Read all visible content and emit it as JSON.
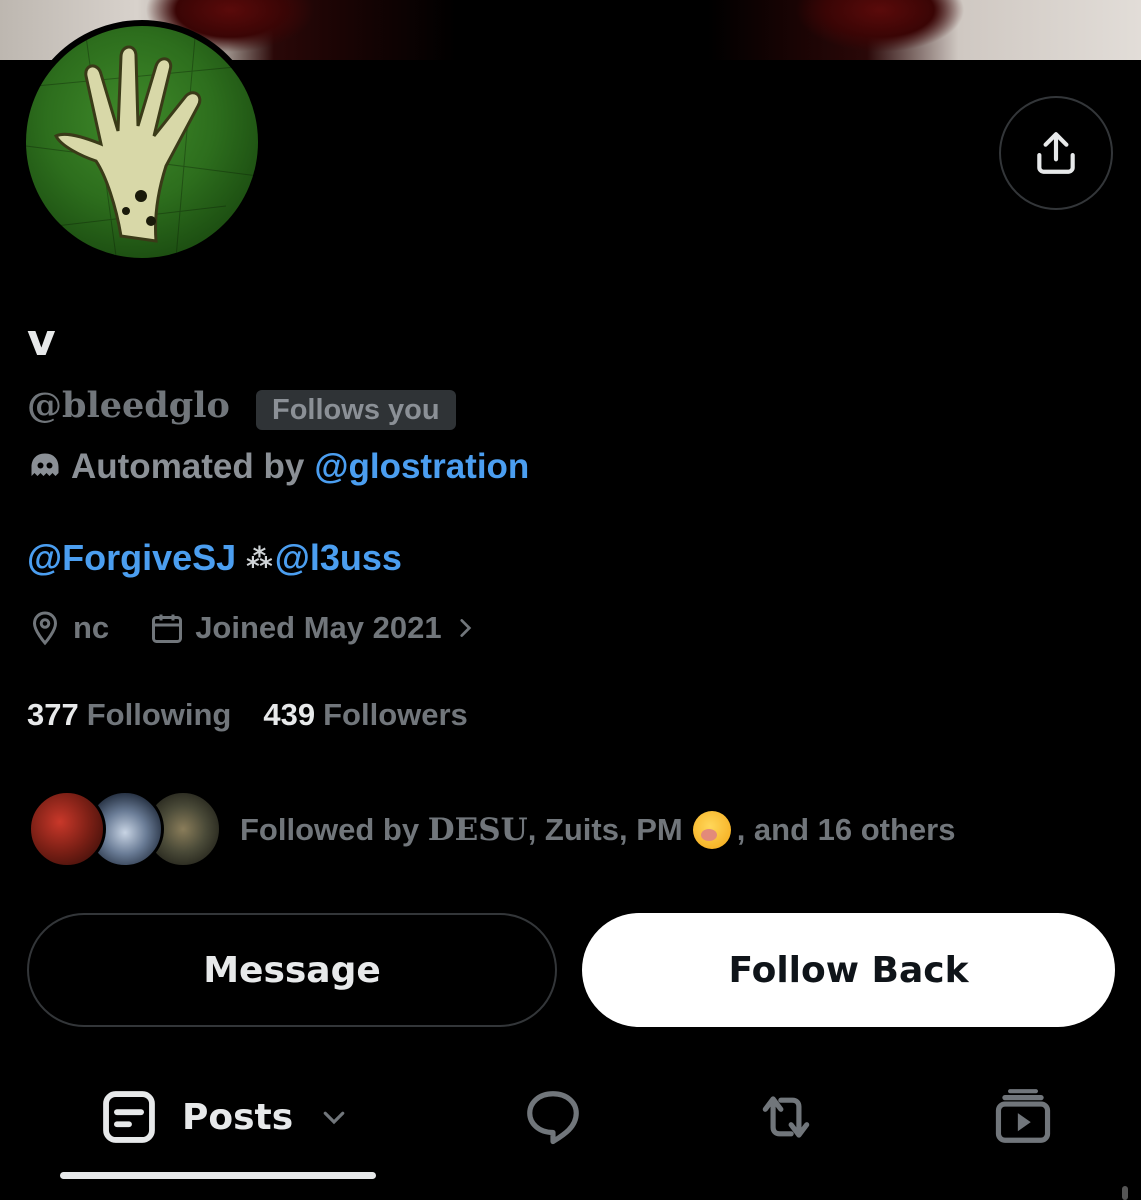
{
  "profile": {
    "display_name": "v",
    "handle": "@bleedglo",
    "follows_you": "Follows you",
    "automated_prefix": "Automated by",
    "automated_by": "@glostration",
    "bio_mention_1": "@ForgiveSJ",
    "bio_sparkle": "⁂",
    "bio_mention_2": "@l3uss",
    "location": "nc",
    "joined": "Joined May 2021"
  },
  "stats": {
    "following_count": "377",
    "following_label": "Following",
    "followers_count": "439",
    "followers_label": "Followers"
  },
  "followed_by": {
    "prefix": "Followed by",
    "name_1": "DESU",
    "name_2": ", Zuits, PM",
    "suffix": ", and 16 others"
  },
  "actions": {
    "message_label": "Message",
    "follow_back_label": "Follow Back"
  },
  "tabs": {
    "posts_label": "Posts"
  },
  "icons": {
    "share": "share-icon",
    "bot": "bot-icon",
    "location": "location-pin-icon",
    "calendar": "calendar-icon",
    "posts": "posts-icon",
    "replies": "reply-bubble-icon",
    "reposts": "repost-icon",
    "videos": "video-library-icon"
  },
  "colors": {
    "background": "#000000",
    "link": "#4b9ef0",
    "muted": "#71767b",
    "text": "#e7e9ea"
  }
}
